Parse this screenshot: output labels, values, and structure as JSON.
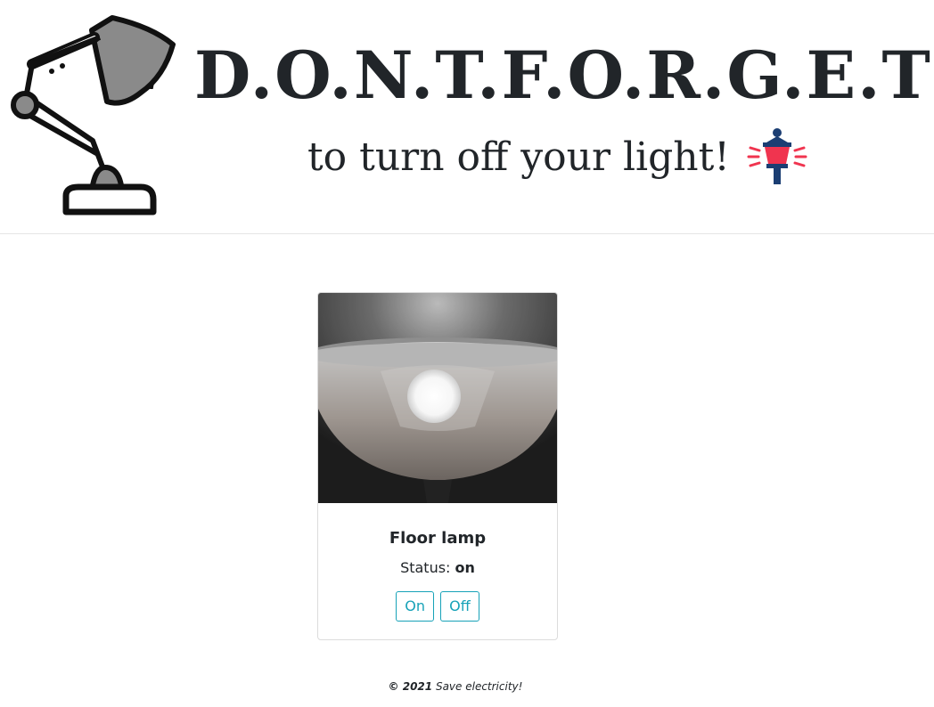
{
  "header": {
    "title": "D.O.N.T.F.O.R.G.E.T",
    "subtitle": "to turn off your light!",
    "logo_icon": "desk-lamp-icon",
    "subtitle_icon": "street-lamp-icon"
  },
  "devices": [
    {
      "name": "Floor lamp",
      "status_label": "Status:",
      "status_value": "on",
      "image": "floor-lamp-photo",
      "buttons": {
        "on_label": "On",
        "off_label": "Off"
      }
    }
  ],
  "footer": {
    "symbol": "©",
    "year": "2021",
    "text": "Save electricity!"
  },
  "colors": {
    "accent": "#17a2b8",
    "text": "#212529",
    "lamp_shade": "#8a8a8a",
    "bulb_glow": "#f6c150",
    "street_lamp_red": "#f0344f",
    "street_lamp_blue": "#1b3e73"
  }
}
